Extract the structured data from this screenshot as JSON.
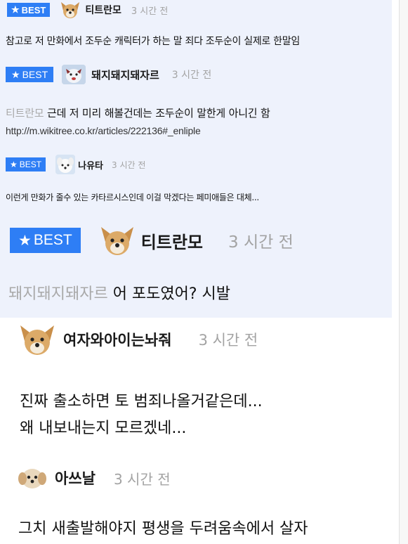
{
  "colors": {
    "best_badge": "#2e7ef5",
    "best_background": "#eef2fc",
    "time": "#a3a3a3",
    "mention": "#a9a9a9"
  },
  "comments": [
    {
      "best": true,
      "badge": "BEST",
      "badge_icon": "star-icon",
      "avatar": "dog-face-icon",
      "nickname": "티트란모",
      "time": "3 시간 전",
      "lines": [
        "참고로 저 만화에서 조두순 캐릭터가 하는 말 죄다 조두순이 실제로 한말임"
      ]
    },
    {
      "best": true,
      "badge": "BEST",
      "badge_icon": "star-icon",
      "avatar": "cartoon-character-icon",
      "nickname": "돼지돼지돼자르",
      "time": "3 시간 전",
      "mention": "티트란모",
      "lines": [
        "근데 저 미리 해볼건데는 조두순이 말한게 아니긴 함"
      ],
      "link": "http://m.wikitree.co.kr/articles/222136#_enliple"
    },
    {
      "best": true,
      "badge": "BEST",
      "badge_icon": "star-icon",
      "avatar": "white-dog-icon",
      "nickname": "나유타",
      "time": "3 시간 전",
      "lines": [
        "이런게 만화가 줄수 있는 카타르시스인데 이걸 막겠다는 페미애들은 대체..."
      ]
    },
    {
      "best": true,
      "badge": "BEST",
      "badge_icon": "star-icon",
      "avatar": "dog-face-icon",
      "nickname": "티트란모",
      "time": "3 시간 전",
      "mention": "돼지돼지돼자르",
      "lines": [
        "어 포도였어? 시발"
      ]
    },
    {
      "best": false,
      "avatar": "dog-face-icon",
      "nickname": "여자와아이는놔줘",
      "time": "3 시간 전",
      "lines": [
        "진짜 출소하면 토 범죄나올거같은데...",
        "왜 내보내는지 모르겠네..."
      ]
    },
    {
      "best": false,
      "avatar": "fluffy-dog-icon",
      "nickname": "아쓰날",
      "time": "3 시간 전",
      "lines": [
        "그치 새출발해야지 평생을 두려움속에서 살자"
      ]
    }
  ]
}
